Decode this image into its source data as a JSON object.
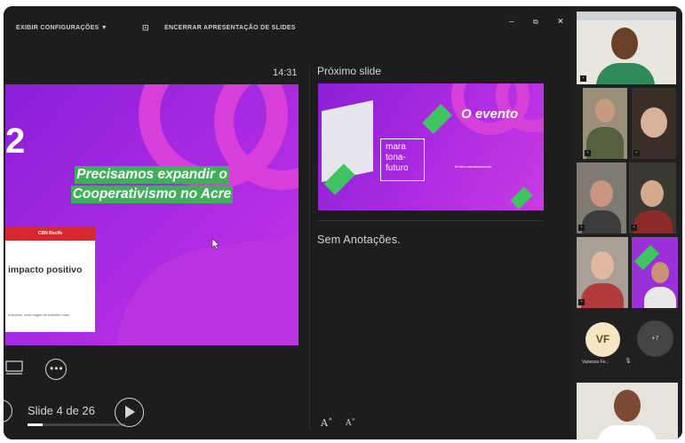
{
  "toolbar": {
    "display_settings": "EXIBIR CONFIGURAÇÕES ▼",
    "end_slideshow": "ENCERRAR APRESENTAÇÃO DE SLIDES"
  },
  "window_controls": {
    "minimize": "–",
    "restore": "⧉",
    "close": "×"
  },
  "presenter": {
    "clock": "14:31",
    "next_slide_label": "Próximo slide",
    "notes": "Sem Anotações.",
    "slide_counter": "Slide 4 de 26",
    "progress": 0.15
  },
  "current_slide": {
    "number_fragment": "2",
    "headline_line1": "Precisamos expandir o",
    "headline_line2": "Cooperativismo no Acre",
    "card_brand": "CBN Recife",
    "card_title": "impacto positivo",
    "card_small": "unicípios, mais vagas de trabalho mias."
  },
  "next_slide": {
    "title": "O evento",
    "label_line1": "mara",
    "label_line2": "tona-",
    "label_line3": "futuro",
    "tiny_text": "territorioabrasemancao"
  },
  "participants": {
    "avatar_initials": "VF",
    "more_count": "+7",
    "avatar_name": "Vanessa Fe..."
  },
  "colors": {
    "slide_purple": "#a529e3",
    "highlight_green": "#3fb05a",
    "app_background": "#1d1d1d"
  }
}
